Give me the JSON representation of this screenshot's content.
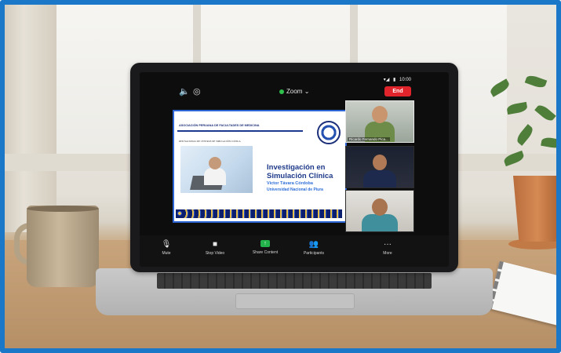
{
  "status_bar": {
    "signal": "▾◢",
    "battery": "▮",
    "time": "10:00"
  },
  "top_bar": {
    "speaker_icon": "speaker-icon",
    "camera_flip_icon": "camera-flip-icon",
    "meeting_label": "Zoom",
    "meeting_chevron": "⌄",
    "end_label": "End"
  },
  "slide": {
    "association": "ASOCIACIÓN PERUANA DE FACULTADES DE MEDICINA",
    "network": "RED NACIONAL DE CENTROS DE SIMULACIÓN CLÍNICA",
    "title": "Investigación en Simulación Clínica",
    "author": "Victor Távara Córdoba",
    "university": "Universidad Nacional de Piura"
  },
  "participants": [
    {
      "name": "Ricardo Fernando Pica..."
    },
    {
      "name": ""
    },
    {
      "name": ""
    }
  ],
  "toolbar": {
    "mute": "Mute",
    "stop_video": "Stop Video",
    "share_content": "Share Content",
    "participants": "Participants",
    "more": "More"
  }
}
